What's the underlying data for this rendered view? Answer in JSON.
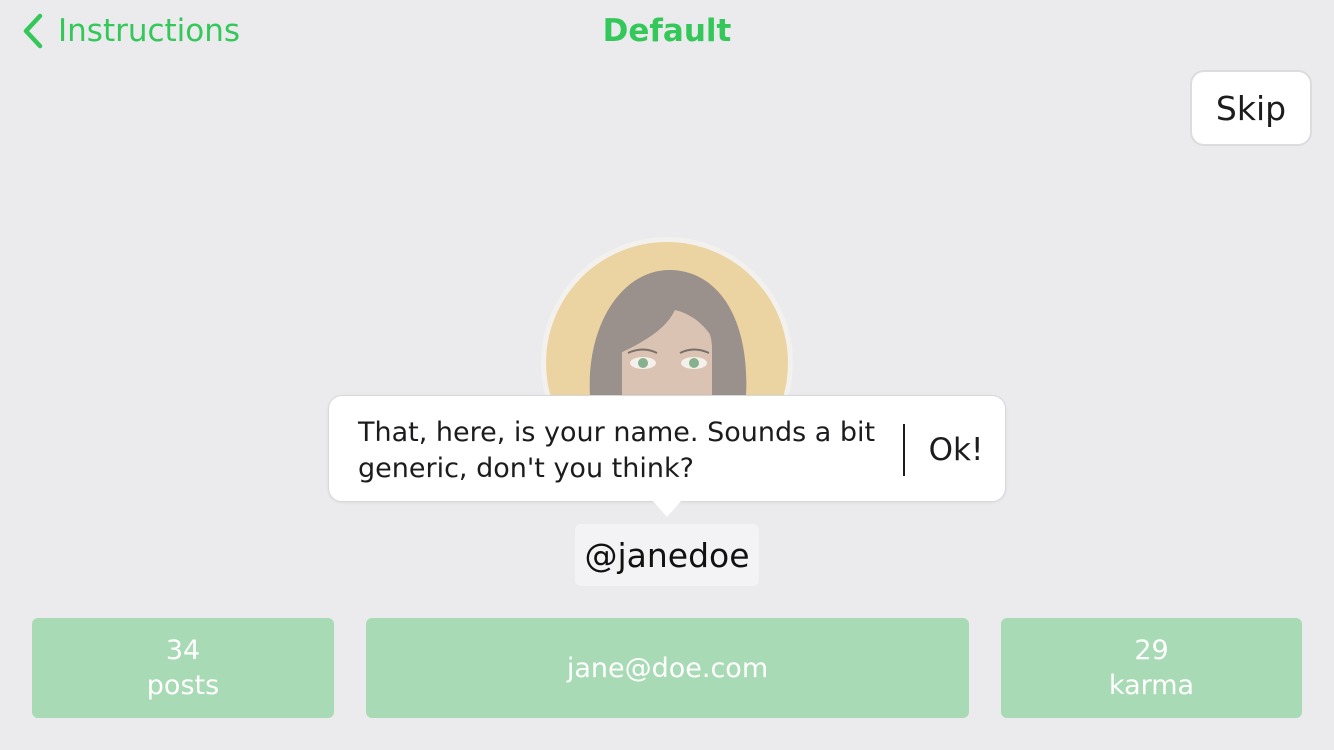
{
  "nav": {
    "back_label": "Instructions",
    "title": "Default",
    "back_icon": "chevron-left-icon"
  },
  "skip": {
    "label": "Skip"
  },
  "avatar": {
    "icon": "avatar-woman-illustration"
  },
  "tooltip": {
    "text": "That, here, is your name. Sounds a bit generic, don't you think?",
    "ok_label": "Ok!"
  },
  "profile": {
    "username": "@janedoe",
    "posts_count": "34",
    "posts_label": "posts",
    "email": "jane@doe.com",
    "karma_count": "29",
    "karma_label": "karma"
  },
  "colors": {
    "accent": "#34c759",
    "background": "#ebebed",
    "stat_box": "#a8dbb5",
    "avatar_bg": "#ecd4a2",
    "hair": "#9a908c"
  }
}
